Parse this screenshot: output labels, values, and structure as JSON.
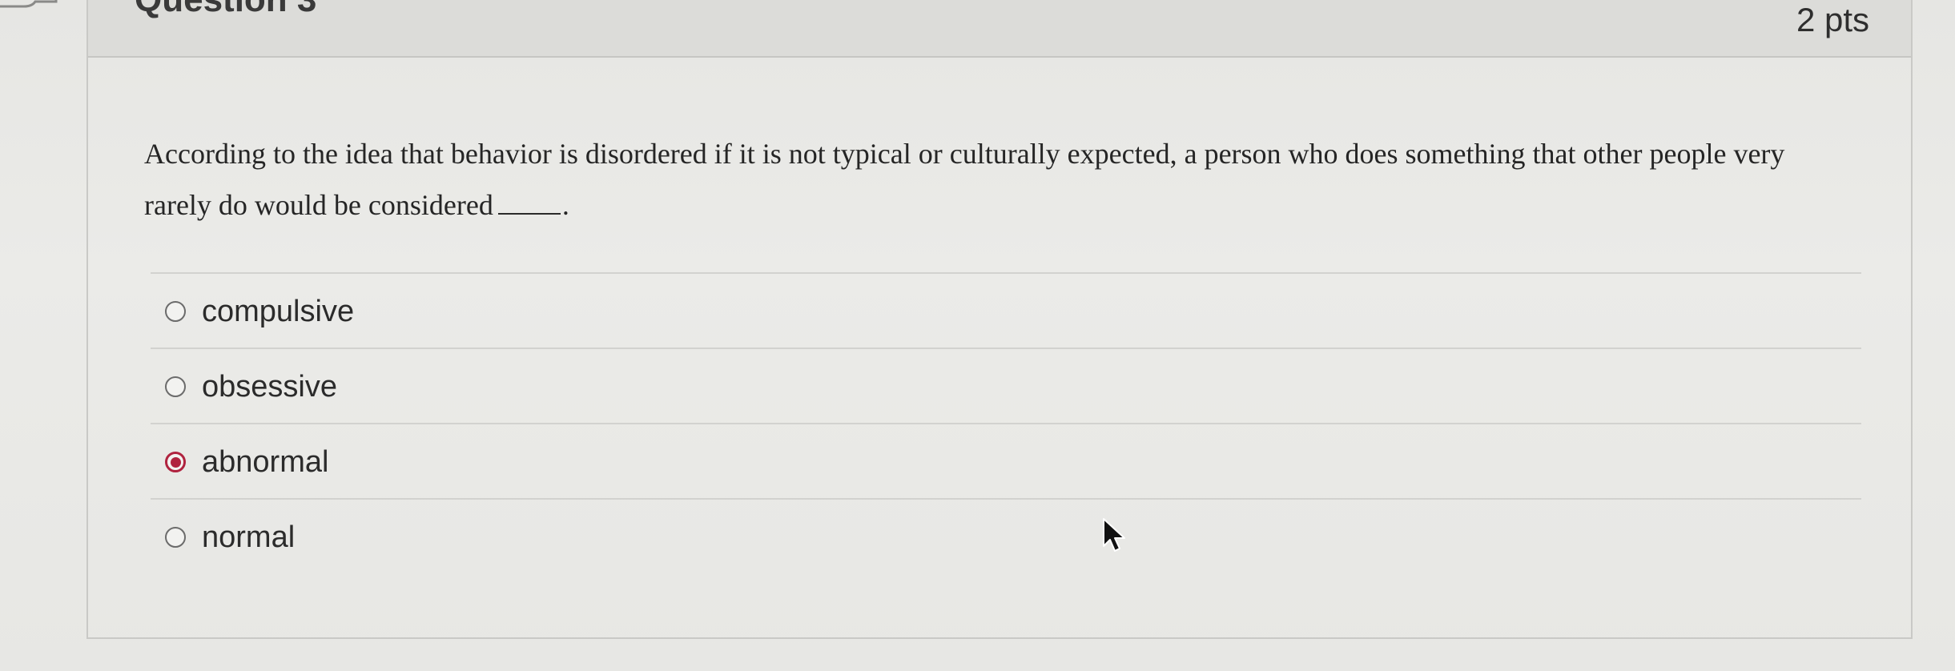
{
  "question": {
    "title": "Question 3",
    "points": "2 pts",
    "text_before_blank": "According to the idea that behavior is disordered if it is not typical or culturally expected, a person who does something that other people very rarely do would be considered",
    "text_after_blank": "."
  },
  "answers": [
    {
      "label": "compulsive",
      "selected": false
    },
    {
      "label": "obsessive",
      "selected": false
    },
    {
      "label": "abnormal",
      "selected": true
    },
    {
      "label": "normal",
      "selected": false
    }
  ],
  "colors": {
    "selected_radio": "#b0233f",
    "header_bg": "#dcdcd9"
  },
  "icons": {
    "flag": "flag-icon",
    "cursor": "mouse-pointer-icon"
  }
}
